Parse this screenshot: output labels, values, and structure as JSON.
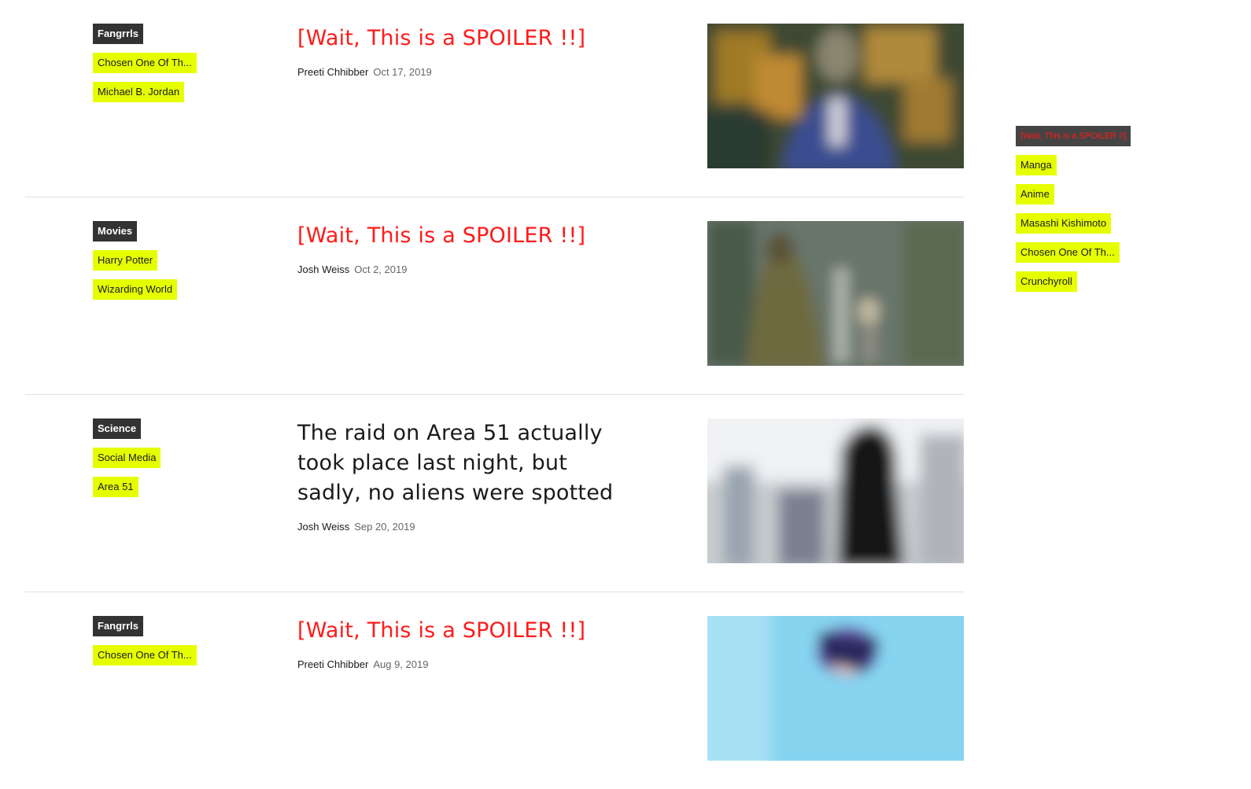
{
  "articles": [
    {
      "tags": [
        "Fangrrls",
        "Chosen One Of Th...",
        "Michael B. Jordan"
      ],
      "title": "[Wait, This is a SPOILER !!]",
      "author": "Preeti Chhibber",
      "date": "Oct 17, 2019"
    },
    {
      "tags": [
        "Movies",
        "Harry Potter",
        "Wizarding World"
      ],
      "title": "[Wait, This is a SPOILER !!]",
      "author": "Josh Weiss",
      "date": "Oct 2, 2019"
    },
    {
      "tags": [
        "Science",
        "Social Media",
        "Area 51"
      ],
      "title": "The raid on Area 51 actually took place last night, but sadly, no aliens were spotted",
      "author": "Josh Weiss",
      "date": "Sep 20, 2019"
    },
    {
      "tags": [
        "Fangrrls",
        "Chosen One Of Th..."
      ],
      "title": "[Wait, This is a SPOILER !!]",
      "author": "Preeti Chhibber",
      "date": "Aug 9, 2019"
    }
  ],
  "sidebar": {
    "tags": [
      "[Wait, This is a SPOILER !!]",
      "Manga",
      "Anime",
      "Masashi Kishimoto",
      "Chosen One Of Th...",
      "Crunchyroll"
    ]
  },
  "colors": {
    "tag_yellow": "#e5ff00",
    "tag_dark": "#333333",
    "spoiler_red": "#ff1a1a"
  }
}
